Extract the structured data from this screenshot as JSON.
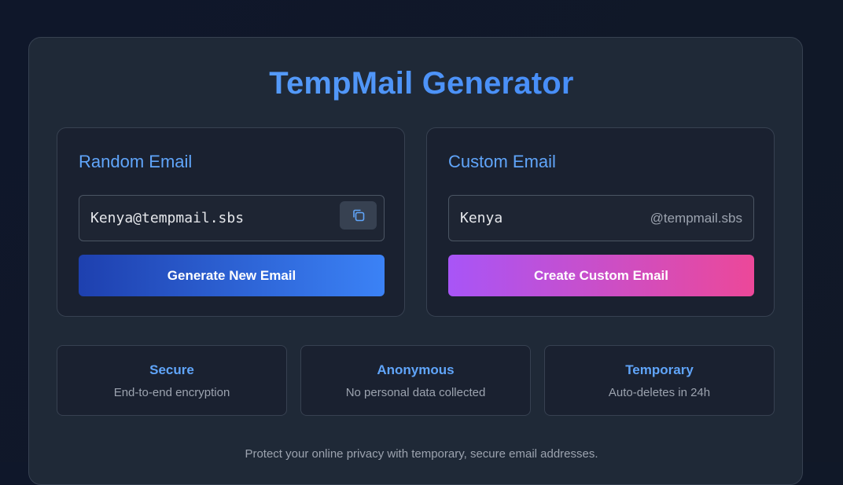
{
  "app": {
    "title": "TempMail Generator"
  },
  "random": {
    "title": "Random Email",
    "email": "Kenya@tempmail.sbs",
    "copy_icon": "copy-icon",
    "button_label": "Generate New Email"
  },
  "custom": {
    "title": "Custom Email",
    "username_value": "Kenya",
    "domain": "@tempmail.sbs",
    "button_label": "Create Custom Email"
  },
  "features": [
    {
      "title": "Secure",
      "desc": "End-to-end encryption"
    },
    {
      "title": "Anonymous",
      "desc": "No personal data collected"
    },
    {
      "title": "Temporary",
      "desc": "Auto-deletes in 24h"
    }
  ],
  "footer": {
    "text": "Protect your online privacy with temporary, secure email addresses."
  },
  "colors": {
    "accent": "#60a5fa",
    "primary_gradient": [
      "#1e40af",
      "#3b82f6"
    ],
    "custom_gradient": [
      "#a855f7",
      "#ec4899"
    ]
  }
}
